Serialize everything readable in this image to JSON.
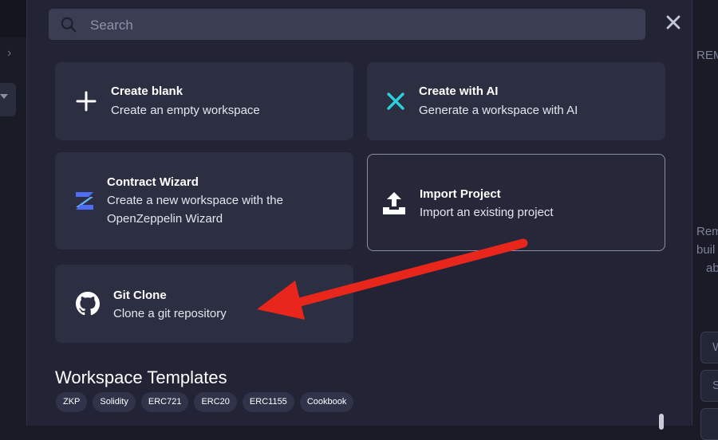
{
  "search": {
    "placeholder": "Search",
    "value": ""
  },
  "cards": {
    "create_blank": {
      "title": "Create blank",
      "description": "Create an empty workspace",
      "icon": "plus-icon"
    },
    "create_ai": {
      "title": "Create with AI",
      "description": "Generate a workspace with AI",
      "icon": "ai-sparkle-icon"
    },
    "contract_wizard": {
      "title": "Contract Wizard",
      "description_line1": "Create a new workspace with the",
      "description_line2": "OpenZeppelin Wizard",
      "icon": "openzeppelin-icon"
    },
    "import_project": {
      "title": "Import Project",
      "description": "Import an existing project",
      "icon": "upload-icon"
    },
    "git_clone": {
      "title": "Git Clone",
      "description": "Clone a git repository",
      "icon": "github-icon"
    }
  },
  "templates": {
    "title": "Workspace Templates",
    "tags": [
      "ZKP",
      "Solidity",
      "ERC721",
      "ERC20",
      "ERC1155",
      "Cookbook"
    ]
  },
  "background": {
    "right_header": "REM",
    "right_lines": [
      "Rem",
      "buil",
      "ab"
    ],
    "right_buttons": [
      "W",
      "S"
    ]
  },
  "colors": {
    "accent_arrow": "#e8261c",
    "ai_icon": "#2ad1d9",
    "wizard_icon": "#4e6cf5"
  }
}
